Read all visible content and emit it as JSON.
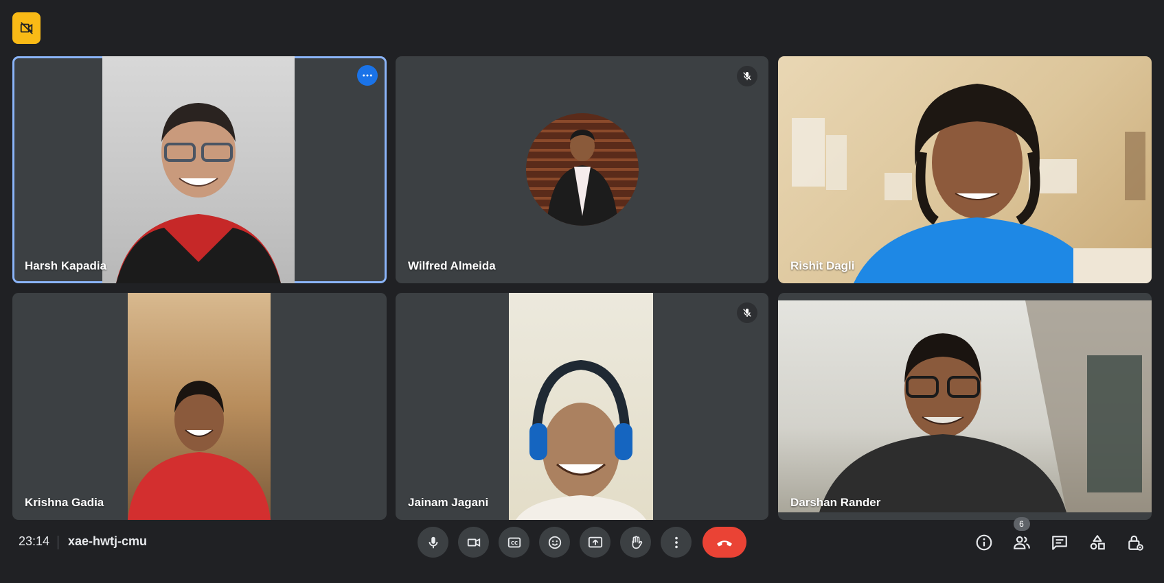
{
  "meeting": {
    "time": "23:14",
    "code": "xae-hwtj-cmu",
    "participant_count": "6"
  },
  "participants": [
    {
      "name": "Harsh Kapadia",
      "active": true,
      "muted": false
    },
    {
      "name": "Wilfred Almeida",
      "active": false,
      "muted": true
    },
    {
      "name": "Rishit Dagli",
      "active": false,
      "muted": false
    },
    {
      "name": "Krishna Gadia",
      "active": false,
      "muted": false
    },
    {
      "name": "Jainam Jagani",
      "active": false,
      "muted": true
    },
    {
      "name": "Darshan Rander",
      "active": false,
      "muted": false
    }
  ],
  "controls": {
    "center": [
      "mic-icon",
      "camera-icon",
      "captions-icon",
      "emoji-icon",
      "present-icon",
      "raise-hand-icon",
      "more-options-icon",
      "end-call-icon"
    ],
    "right": [
      "info-icon",
      "people-icon",
      "chat-icon",
      "activities-icon",
      "host-controls-icon"
    ]
  },
  "colors": {
    "background": "#202124",
    "tile": "#3c4043",
    "active_border": "#8ab4f8",
    "end_call": "#ea4335",
    "badge_yellow": "#f9ba16",
    "accent_blue": "#1a73e8"
  }
}
